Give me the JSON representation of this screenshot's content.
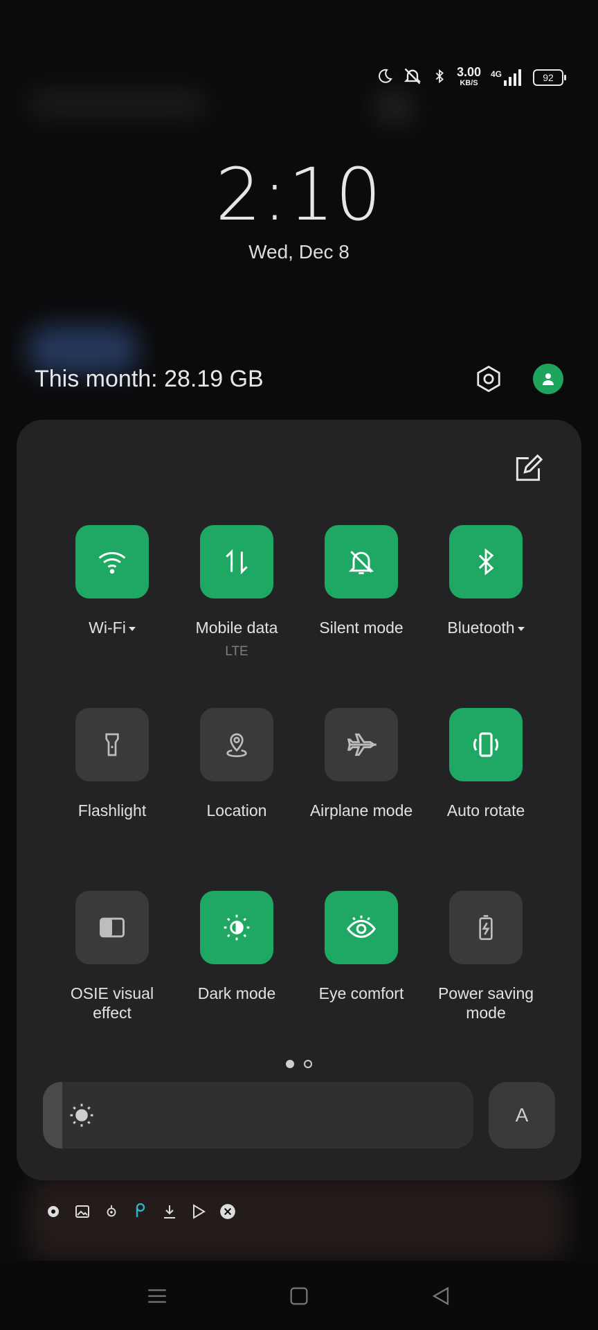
{
  "status_bar": {
    "speed_value": "3.00",
    "speed_unit": "KB/S",
    "network": "4G",
    "battery": "92",
    "icons": [
      "moon-icon",
      "mute-icon",
      "bluetooth-icon",
      "signal-icon",
      "battery-icon"
    ]
  },
  "lockscreen": {
    "time": "2:10",
    "date": "Wed, Dec 8"
  },
  "data_usage": {
    "label": "This month: 28.19 GB"
  },
  "quick_settings": {
    "tiles": [
      {
        "label": "Wi-Fi",
        "state": "on",
        "icon": "wifi-icon",
        "dropdown": true
      },
      {
        "label": "Mobile data",
        "sub": "LTE",
        "state": "on",
        "icon": "mobile-data-icon"
      },
      {
        "label": "Silent mode",
        "state": "on",
        "icon": "silent-bell-icon"
      },
      {
        "label": "Bluetooth",
        "state": "on",
        "icon": "bluetooth-icon",
        "dropdown": true
      },
      {
        "label": "Flashlight",
        "state": "off",
        "icon": "flashlight-icon"
      },
      {
        "label": "Location",
        "state": "off",
        "icon": "location-icon"
      },
      {
        "label": "Airplane mode",
        "state": "off",
        "icon": "airplane-icon"
      },
      {
        "label": "Auto rotate",
        "state": "on",
        "icon": "auto-rotate-icon"
      },
      {
        "label_line1": "OSIE visual",
        "label_line2": "effect",
        "state": "off",
        "icon": "osie-icon"
      },
      {
        "label": "Dark mode",
        "state": "on",
        "icon": "dark-mode-icon"
      },
      {
        "label": "Eye comfort",
        "state": "on",
        "icon": "eye-comfort-icon"
      },
      {
        "label_line1": "Power saving",
        "label_line2": "mode",
        "state": "off",
        "icon": "battery-saver-icon"
      }
    ],
    "page_indicator": {
      "current": 1,
      "total": 2
    },
    "brightness": {
      "level": 0.04
    },
    "auto_brightness_label": "A"
  },
  "colors": {
    "accent_green": "#1fa863",
    "tile_off": "#3a3a3c",
    "panel_bg": "#232325"
  },
  "navbar": {
    "buttons": [
      "menu-icon",
      "home-icon",
      "back-icon"
    ]
  }
}
